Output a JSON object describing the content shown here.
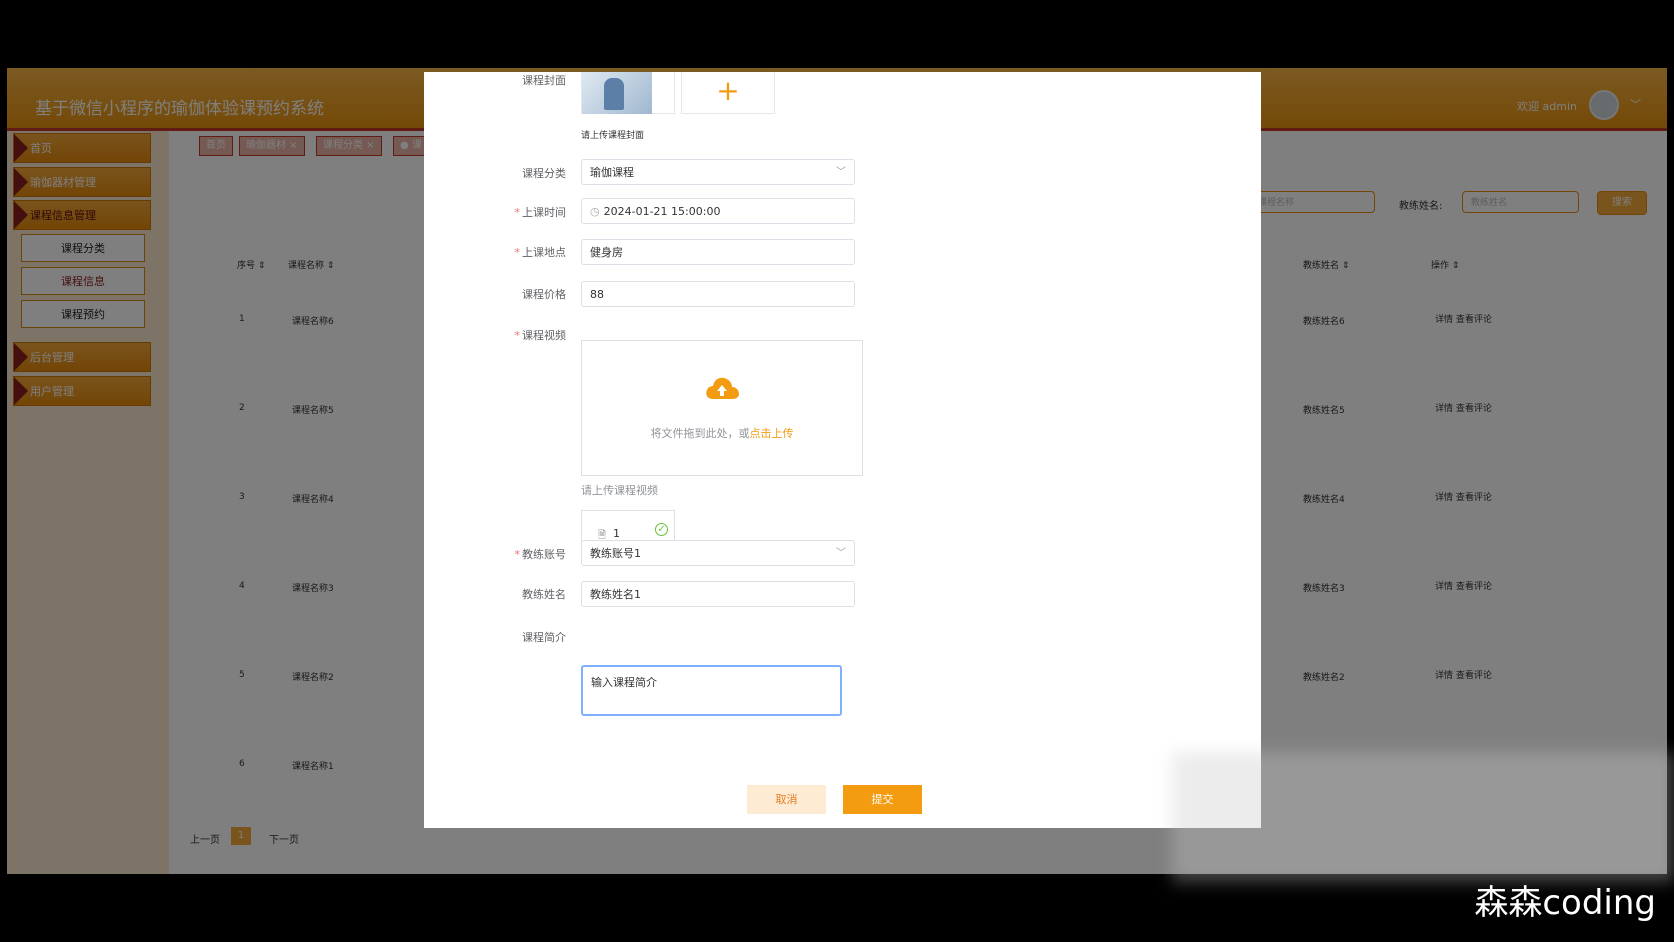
{
  "app": {
    "title": "基于微信小程序的瑜伽体验课预约系统",
    "welcome": "欢迎 admin",
    "chevron": "﹀"
  },
  "sidebar": {
    "items": [
      {
        "label": "首页"
      },
      {
        "label": "瑜伽器材管理"
      },
      {
        "label": "课程信息管理"
      },
      {
        "label": "后台管理"
      },
      {
        "label": "用户管理"
      }
    ],
    "subitems": [
      {
        "label": "课程分类"
      },
      {
        "label": "课程信息"
      },
      {
        "label": "课程预约"
      }
    ]
  },
  "tabs": [
    {
      "label": "首页"
    },
    {
      "label": "瑜伽器材 ×"
    },
    {
      "label": "课程分类 ×"
    },
    {
      "label": "● 课"
    }
  ],
  "search": {
    "course_placeholder": "课程名称",
    "coach_label": "教练姓名:",
    "coach_placeholder": "教练姓名",
    "button": "搜索"
  },
  "table": {
    "headers": [
      "序号 ⇕",
      "课程名称 ⇕",
      "教练姓名 ⇕",
      "操作 ⇕"
    ],
    "rows": [
      {
        "index": "1",
        "name": "课程名称6",
        "coach": "教练姓名6",
        "ops": "详情  查看评论"
      },
      {
        "index": "2",
        "name": "课程名称5",
        "coach": "教练姓名5",
        "ops": "详情  查看评论"
      },
      {
        "index": "3",
        "name": "课程名称4",
        "coach": "教练姓名4",
        "ops": "详情  查看评论"
      },
      {
        "index": "4",
        "name": "课程名称3",
        "coach": "教练姓名3",
        "ops": "详情  查看评论"
      },
      {
        "index": "5",
        "name": "课程名称2",
        "coach": "教练姓名2",
        "ops": "详情  查看评论"
      },
      {
        "index": "6",
        "name": "课程名称1",
        "coach": "",
        "ops": ""
      }
    ]
  },
  "pager": {
    "prev": "上一页",
    "current": "1",
    "next": "下一页"
  },
  "form": {
    "cover_label": "课程封面",
    "cover_hint": "请上传课程封面",
    "plus": "+",
    "category_label": "课程分类",
    "category_value": "瑜伽课程",
    "time_label": "上课时间",
    "time_value": "2024-01-21 15:00:00",
    "time_icon": "◷",
    "place_label": "上课地点",
    "place_value": "健身房",
    "price_label": "课程价格",
    "price_value": "88",
    "video_label": "课程视频",
    "upload_text": "将文件拖到此处，或",
    "upload_link": "点击上传",
    "video_hint": "请上传课程视频",
    "file_name": "1",
    "file_icon": "🗎",
    "file_ok": "✓",
    "coach_account_label": "教练账号",
    "coach_account_value": "教练账号1",
    "coach_name_label": "教练姓名",
    "coach_name_value": "教练姓名1",
    "intro_label": "课程简介",
    "intro_value": "输入课程简介",
    "required_mark": "*",
    "arrow": "﹀",
    "cancel": "取消",
    "submit": "提交"
  },
  "watermark": "森森coding"
}
